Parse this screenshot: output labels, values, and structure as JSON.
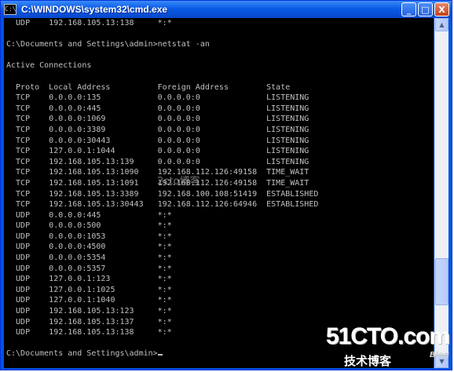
{
  "window": {
    "title": "C:\\WINDOWS\\system32\\cmd.exe",
    "minimize_label": "_",
    "maximize_label": "□",
    "close_label": "X",
    "app_icon_label": "C:\\"
  },
  "console": {
    "lines": [
      "  UDP    192.168.105.13:138     *:*",
      "",
      "C:\\Documents and Settings\\admin>netstat -an",
      "",
      "Active Connections",
      "",
      "  Proto  Local Address          Foreign Address        State",
      "  TCP    0.0.0.0:135            0.0.0.0:0              LISTENING",
      "  TCP    0.0.0.0:445            0.0.0.0:0              LISTENING",
      "  TCP    0.0.0.0:1069           0.0.0.0:0              LISTENING",
      "  TCP    0.0.0.0:3389           0.0.0.0:0              LISTENING",
      "  TCP    0.0.0.0:30443          0.0.0.0:0              LISTENING",
      "  TCP    127.0.0.1:1044         0.0.0.0:0              LISTENING",
      "  TCP    192.168.105.13:139     0.0.0.0:0              LISTENING",
      "  TCP    192.168.105.13:1090    192.168.112.126:49158  TIME_WAIT",
      "  TCP    192.168.105.13:1091    192.168.112.126:49158  TIME_WAIT",
      "  TCP    192.168.105.13:3389    192.168.100.108:51419  ESTABLISHED",
      "  TCP    192.168.105.13:30443   192.168.112.126:64946  ESTABLISHED",
      "  UDP    0.0.0.0:445            *:*",
      "  UDP    0.0.0.0:500            *:*",
      "  UDP    0.0.0.0:1053           *:*",
      "  UDP    0.0.0.0:4500           *:*",
      "  UDP    0.0.0.0:5354           *:*",
      "  UDP    0.0.0.0:5357           *:*",
      "  UDP    127.0.0.1:123          *:*",
      "  UDP    127.0.0.1:1025         *:*",
      "  UDP    127.0.0.1:1040         *:*",
      "  UDP    192.168.105.13:123     *:*",
      "  UDP    192.168.105.13:137     *:*",
      "  UDP    192.168.105.13:138     *:*",
      "",
      "C:\\Documents and Settings\\admin>"
    ]
  },
  "watermark": "2cto博客",
  "logo": {
    "main": "51CTO.com",
    "sub": "技术博客",
    "blog": "Blog"
  }
}
